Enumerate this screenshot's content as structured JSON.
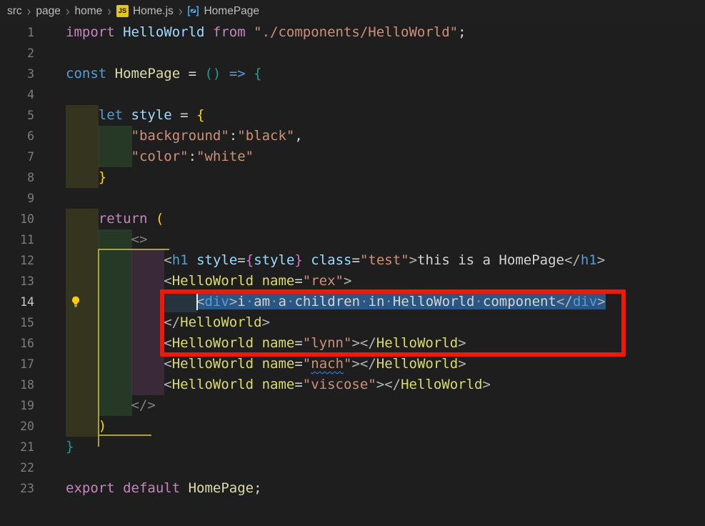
{
  "breadcrumb": {
    "separator": "›",
    "items": [
      {
        "label": "src"
      },
      {
        "label": "page"
      },
      {
        "label": "home"
      },
      {
        "label": "Home.js",
        "icon": "js"
      },
      {
        "label": "HomePage",
        "icon": "symbol"
      }
    ]
  },
  "colors": {
    "annotation_red": "#f01808",
    "selection_blue": "#2a5684",
    "bracket_gold": "#ffd700",
    "bracket_teal": "#1e9e96",
    "bracket_pink": "#da70d6",
    "lightbulb_yellow": "#ffcc00",
    "js_icon_yellow": "#e7c41a",
    "squiggle_blue": "#3d8be0"
  },
  "editor": {
    "lines": [
      {
        "n": 1,
        "segs": [
          {
            "t": "import ",
            "c": "p"
          },
          {
            "t": "HelloWorld",
            "c": "lb"
          },
          {
            "t": " ",
            "c": "w"
          },
          {
            "t": "from ",
            "c": "p"
          },
          {
            "t": "\"./components/HelloWorld\"",
            "c": "s"
          },
          {
            "t": ";",
            "c": "w"
          }
        ]
      },
      {
        "n": 2,
        "segs": []
      },
      {
        "n": 3,
        "segs": [
          {
            "t": "const ",
            "c": "b"
          },
          {
            "t": "HomePage",
            "c": "fy"
          },
          {
            "t": " = ",
            "c": "w"
          },
          {
            "t": "()",
            "c": "teal"
          },
          {
            "t": " ",
            "c": "w"
          },
          {
            "t": "=>",
            "c": "b"
          },
          {
            "t": " ",
            "c": "w"
          },
          {
            "t": "{",
            "c": "teal"
          }
        ]
      },
      {
        "n": 4,
        "segs": []
      },
      {
        "n": 5,
        "blocks": [
          1
        ],
        "segs": [
          {
            "t": "    ",
            "c": "w"
          },
          {
            "t": "let ",
            "c": "b"
          },
          {
            "t": "style",
            "c": "lb"
          },
          {
            "t": " = ",
            "c": "w"
          },
          {
            "t": "{",
            "c": "gold"
          }
        ]
      },
      {
        "n": 6,
        "blocks": [
          1,
          2
        ],
        "segs": [
          {
            "t": "        ",
            "c": "w"
          },
          {
            "t": "\"background\"",
            "c": "s"
          },
          {
            "t": ":",
            "c": "w"
          },
          {
            "t": "\"black\"",
            "c": "s"
          },
          {
            "t": ",",
            "c": "w"
          }
        ]
      },
      {
        "n": 7,
        "blocks": [
          1,
          2
        ],
        "segs": [
          {
            "t": "        ",
            "c": "w"
          },
          {
            "t": "\"color\"",
            "c": "s"
          },
          {
            "t": ":",
            "c": "w"
          },
          {
            "t": "\"white\"",
            "c": "s"
          }
        ]
      },
      {
        "n": 8,
        "blocks": [
          1
        ],
        "segs": [
          {
            "t": "    ",
            "c": "w"
          },
          {
            "t": "}",
            "c": "gold"
          }
        ]
      },
      {
        "n": 9,
        "segs": []
      },
      {
        "n": 10,
        "blocks": [
          1
        ],
        "segs": [
          {
            "t": "    ",
            "c": "w"
          },
          {
            "t": "return ",
            "c": "p"
          },
          {
            "t": "(",
            "c": "gold"
          }
        ]
      },
      {
        "n": 11,
        "blocks": [
          1,
          2
        ],
        "segs": [
          {
            "t": "        ",
            "c": "w"
          },
          {
            "t": "<>",
            "c": "fr"
          }
        ]
      },
      {
        "n": 12,
        "blocks": [
          1,
          2,
          3
        ],
        "segs": [
          {
            "t": "            ",
            "c": "w"
          },
          {
            "t": "<",
            "c": "g"
          },
          {
            "t": "h1",
            "c": "b"
          },
          {
            "t": " ",
            "c": "w"
          },
          {
            "t": "style",
            "c": "lb"
          },
          {
            "t": "=",
            "c": "w"
          },
          {
            "t": "{",
            "c": "pk"
          },
          {
            "t": "style",
            "c": "lb"
          },
          {
            "t": "}",
            "c": "pk"
          },
          {
            "t": " ",
            "c": "w"
          },
          {
            "t": "class",
            "c": "lb"
          },
          {
            "t": "=",
            "c": "w"
          },
          {
            "t": "\"test\"",
            "c": "s"
          },
          {
            "t": ">",
            "c": "g"
          },
          {
            "t": "this is a HomePage",
            "c": "w"
          },
          {
            "t": "</",
            "c": "g"
          },
          {
            "t": "h1",
            "c": "b"
          },
          {
            "t": ">",
            "c": "g"
          }
        ]
      },
      {
        "n": 13,
        "blocks": [
          1,
          2,
          3
        ],
        "segs": [
          {
            "t": "            ",
            "c": "w"
          },
          {
            "t": "<",
            "c": "g"
          },
          {
            "t": "HelloWorld",
            "c": "jy"
          },
          {
            "t": " ",
            "c": "w"
          },
          {
            "t": "name",
            "c": "jy"
          },
          {
            "t": "=",
            "c": "w"
          },
          {
            "t": "\"rex\"",
            "c": "s"
          },
          {
            "t": ">",
            "c": "g"
          }
        ]
      },
      {
        "n": 14,
        "active": true,
        "bulb": true,
        "cursor": 16,
        "blocks": [
          1,
          2,
          3,
          4
        ],
        "segs": [
          {
            "t": "                ",
            "c": "w"
          },
          {
            "t": "<",
            "c": "g",
            "sel": true
          },
          {
            "t": "div",
            "c": "b",
            "sel": true
          },
          {
            "t": ">",
            "c": "g",
            "sel": true
          },
          {
            "t": "i am a children in HelloWorld component",
            "c": "w",
            "sel": true
          },
          {
            "t": "</",
            "c": "g",
            "sel": true
          },
          {
            "t": "div",
            "c": "b",
            "sel": true
          },
          {
            "t": ">",
            "c": "g",
            "sel": true
          }
        ]
      },
      {
        "n": 15,
        "blocks": [
          1,
          2,
          3
        ],
        "segs": [
          {
            "t": "            ",
            "c": "w"
          },
          {
            "t": "</",
            "c": "g"
          },
          {
            "t": "HelloWorld",
            "c": "jy"
          },
          {
            "t": ">",
            "c": "g"
          }
        ]
      },
      {
        "n": 16,
        "blocks": [
          1,
          2,
          3
        ],
        "segs": [
          {
            "t": "            ",
            "c": "w"
          },
          {
            "t": "<",
            "c": "g"
          },
          {
            "t": "HelloWorld",
            "c": "jy"
          },
          {
            "t": " ",
            "c": "w"
          },
          {
            "t": "name",
            "c": "jy"
          },
          {
            "t": "=",
            "c": "w"
          },
          {
            "t": "\"lynn\"",
            "c": "s"
          },
          {
            "t": "></",
            "c": "g"
          },
          {
            "t": "HelloWorld",
            "c": "jy"
          },
          {
            "t": ">",
            "c": "g"
          }
        ]
      },
      {
        "n": 17,
        "blocks": [
          1,
          2,
          3
        ],
        "segs": [
          {
            "t": "            ",
            "c": "w"
          },
          {
            "t": "<",
            "c": "g"
          },
          {
            "t": "HelloWorld",
            "c": "jy"
          },
          {
            "t": " ",
            "c": "w"
          },
          {
            "t": "name",
            "c": "jy"
          },
          {
            "t": "=",
            "c": "w"
          },
          {
            "t": "\"",
            "c": "s"
          },
          {
            "t": "nach",
            "c": "s sq"
          },
          {
            "t": "\"",
            "c": "s"
          },
          {
            "t": "></",
            "c": "g"
          },
          {
            "t": "HelloWorld",
            "c": "jy"
          },
          {
            "t": ">",
            "c": "g"
          }
        ]
      },
      {
        "n": 18,
        "blocks": [
          1,
          2,
          3
        ],
        "segs": [
          {
            "t": "            ",
            "c": "w"
          },
          {
            "t": "<",
            "c": "g"
          },
          {
            "t": "HelloWorld",
            "c": "jy"
          },
          {
            "t": " ",
            "c": "w"
          },
          {
            "t": "name",
            "c": "jy"
          },
          {
            "t": "=",
            "c": "w"
          },
          {
            "t": "\"viscose\"",
            "c": "s"
          },
          {
            "t": "></",
            "c": "g"
          },
          {
            "t": "HelloWorld",
            "c": "jy"
          },
          {
            "t": ">",
            "c": "g"
          }
        ]
      },
      {
        "n": 19,
        "blocks": [
          1,
          2
        ],
        "segs": [
          {
            "t": "        ",
            "c": "w"
          },
          {
            "t": "</>",
            "c": "fr"
          }
        ]
      },
      {
        "n": 20,
        "blocks": [
          1
        ],
        "segs": [
          {
            "t": "    ",
            "c": "w"
          },
          {
            "t": ")",
            "c": "gold"
          }
        ]
      },
      {
        "n": 21,
        "segs": [
          {
            "t": "}",
            "c": "teal"
          }
        ]
      },
      {
        "n": 22,
        "segs": []
      },
      {
        "n": 23,
        "segs": [
          {
            "t": "export default ",
            "c": "p"
          },
          {
            "t": "HomePage",
            "c": "fy"
          },
          {
            "t": ";",
            "c": "w"
          }
        ]
      }
    ]
  }
}
